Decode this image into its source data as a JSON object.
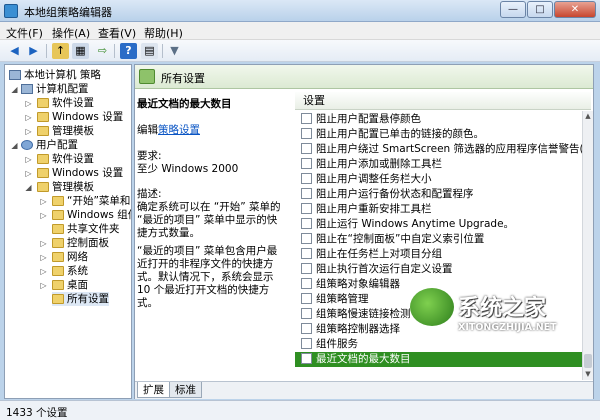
{
  "window": {
    "title": "本地组策略编辑器",
    "min": "—",
    "max": "□",
    "close": "✕"
  },
  "menu": [
    "文件(F)",
    "操作(A)",
    "查看(V)",
    "帮助(H)"
  ],
  "toolbar": {
    "back": "◀",
    "forward": "▶",
    "up": "↑",
    "tree": "▦",
    "export": "⇨",
    "help": "?",
    "props": "▤",
    "filter": "▼"
  },
  "tree": {
    "root": "本地计算机 策略",
    "computer": "计算机配置",
    "computer_children": [
      "软件设置",
      "Windows 设置",
      "管理模板"
    ],
    "user": "用户配置",
    "user_children": [
      "软件设置",
      "Windows 设置",
      "管理模板"
    ],
    "templates_children": [
      "“开始”菜单和",
      "Windows 组件",
      "共享文件夹",
      "控制面板",
      "网络",
      "系统",
      "桌面",
      "所有设置"
    ]
  },
  "panel": {
    "header": "所有设置",
    "setting_title": "最近文档的最大数目",
    "edit_prefix": "编辑",
    "edit_link": "策略设置",
    "req_label": "要求:",
    "req_value": "至少 Windows 2000",
    "desc_label": "描述:",
    "desc_1": "确定系统可以在 “开始” 菜单的 “最近的项目” 菜单中显示的快捷方式数量。",
    "desc_2": "“最近的项目” 菜单包含用户最近打开的非程序文件的快捷方式。默认情况下，系统会显示 10 个最近打开文档的快捷方式。"
  },
  "list": {
    "column": "设置",
    "rows": [
      "阻止用户配置悬停颜色",
      "阻止用户配置已单击的链接的颜色。",
      "阻止用户绕过 SmartScreen 筛选器的应用程序信誉警告(一些...",
      "阻止用户添加或删除工具栏",
      "阻止用户调整任务栏大小",
      "阻止用户运行备份状态和配置程序",
      "阻止用户重新安排工具栏",
      "阻止运行 Windows Anytime Upgrade。",
      "阻止在“控制面板”中自定义索引位置",
      "阻止在任务栏上对项目分组",
      "阻止执行首次运行自定义设置",
      "组策略对象编辑器",
      "组策略管理",
      "组策略慢速链接检测",
      "组策略控制器选择",
      "组件服务",
      "最近文档的最大数目"
    ],
    "selected_index": 16
  },
  "tabs": [
    "扩展",
    "标准"
  ],
  "status": "1433 个设置",
  "watermark": {
    "name": "系统之家",
    "url": "XITONGZHIJIA.NET"
  }
}
